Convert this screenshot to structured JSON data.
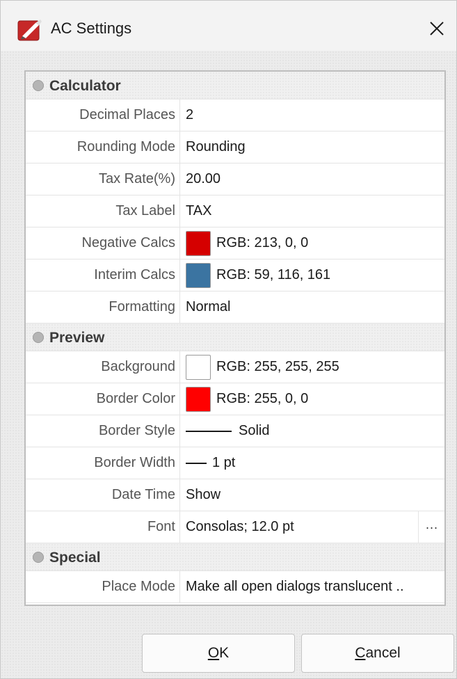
{
  "window": {
    "title": "AC Settings",
    "app_icon": "pdf-editor-app-icon",
    "close_icon": "close-icon"
  },
  "sections": [
    {
      "label": "Calculator",
      "rows": [
        {
          "name": "Decimal Places",
          "value": "2"
        },
        {
          "name": "Rounding Mode",
          "value": "Rounding"
        },
        {
          "name": "Tax Rate(%)",
          "value": "20.00"
        },
        {
          "name": "Tax Label",
          "value": "TAX"
        },
        {
          "name": "Negative Calcs",
          "value": "RGB: 213, 0, 0",
          "color": "#d50000"
        },
        {
          "name": "Interim Calcs",
          "value": "RGB: 59, 116, 161",
          "color": "#3b74a1"
        },
        {
          "name": "Formatting",
          "value": "Normal"
        }
      ]
    },
    {
      "label": "Preview",
      "rows": [
        {
          "name": "Background",
          "value": "RGB: 255, 255, 255",
          "color": "#ffffff"
        },
        {
          "name": "Border Color",
          "value": "RGB: 255, 0, 0",
          "color": "#ff0000"
        },
        {
          "name": "Border Style",
          "value": "Solid"
        },
        {
          "name": "Border Width",
          "value": "1 pt"
        },
        {
          "name": "Date Time",
          "value": "Show"
        },
        {
          "name": "Font",
          "value": "Consolas; 12.0 pt",
          "button": "···"
        }
      ]
    },
    {
      "label": "Special",
      "rows": [
        {
          "name": "Place Mode",
          "value": "Make all open dialogs translucent .."
        }
      ]
    }
  ],
  "buttons": {
    "ok_mnemonic": "O",
    "ok_rest": "K",
    "cancel_mnemonic": "C",
    "cancel_rest": "ancel"
  }
}
